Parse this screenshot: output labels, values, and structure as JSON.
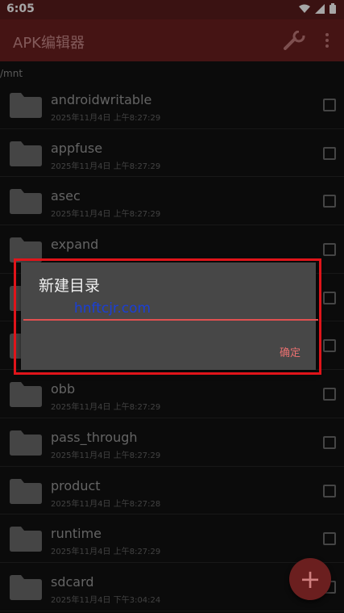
{
  "status_bar": {
    "time": "6:05"
  },
  "toolbar": {
    "title": "APK编辑器"
  },
  "path": "/mnt",
  "files": [
    {
      "name": "androidwritable",
      "date": "2025年11月4日 上午8:27:29"
    },
    {
      "name": "appfuse",
      "date": "2025年11月4日 上午8:27:29"
    },
    {
      "name": "asec",
      "date": "2025年11月4日 上午8:27:29"
    },
    {
      "name": "expand",
      "date": ""
    },
    {
      "name": "",
      "date": ""
    },
    {
      "name": "",
      "date": ""
    },
    {
      "name": "obb",
      "date": "2025年11月4日 上午8:27:29"
    },
    {
      "name": "pass_through",
      "date": "2025年11月4日 上午8:27:29"
    },
    {
      "name": "product",
      "date": "2025年11月4日 上午8:27:28"
    },
    {
      "name": "runtime",
      "date": "2025年11月4日 上午8:27:29"
    },
    {
      "name": "sdcard",
      "date": "2025年11月4日 下午3:04:24"
    }
  ],
  "dialog": {
    "title": "新建目录",
    "input_value": "",
    "watermark": "hnftcjr.com",
    "ok_label": "确定"
  },
  "fab": {
    "icon": "plus-icon",
    "label": "+"
  },
  "colors": {
    "toolbar": "#6b1f1f",
    "accent": "#e05050",
    "highlight_border": "#e0141a"
  }
}
